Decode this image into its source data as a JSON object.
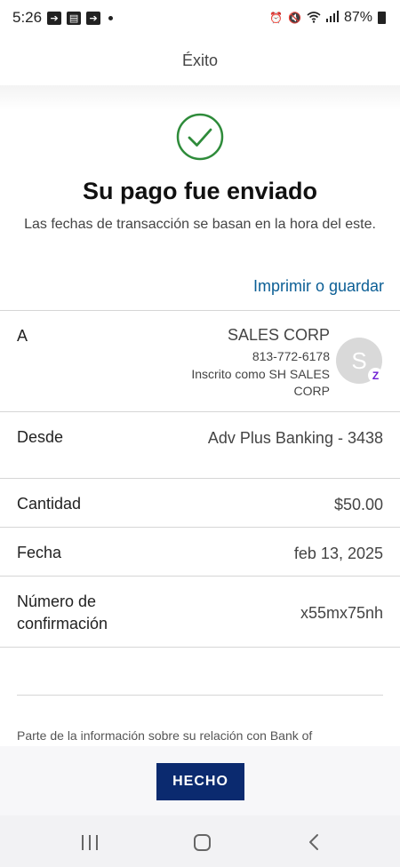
{
  "status_bar": {
    "time": "5:26",
    "battery": "87%"
  },
  "header": {
    "title": "Éxito"
  },
  "hero": {
    "title": "Su pago fue enviado",
    "subtitle": "Las fechas de transacción se basan en la hora del este.",
    "print_link": "Imprimir o guardar"
  },
  "details": {
    "to": {
      "label": "A",
      "name": "SALES CORP",
      "phone": "813-772-6178",
      "enrolled": "Inscrito como SH SALES CORP",
      "avatar_letter": "S",
      "badge": "Z"
    },
    "from": {
      "label": "Desde",
      "value": "Adv Plus Banking - 3438"
    },
    "amount": {
      "label": "Cantidad",
      "value": "$50.00"
    },
    "date": {
      "label": "Fecha",
      "value": "feb 13, 2025"
    },
    "confirmation": {
      "label_line1": "Número de",
      "label_line2": "confirmación",
      "value": "x55mx75nh"
    }
  },
  "disclaimer": "Parte de la información sobre su relación con Bank of",
  "footer": {
    "done_label": "HECHO"
  },
  "colors": {
    "link": "#0b5e95",
    "primary_button": "#0b2a6f",
    "success": "#2e8b3a",
    "zelle": "#6d1ed4"
  },
  "icons": [
    "success-check-icon",
    "zelle-icon",
    "alarm-icon",
    "mute-icon",
    "wifi-icon",
    "signal-icon",
    "battery-icon"
  ]
}
